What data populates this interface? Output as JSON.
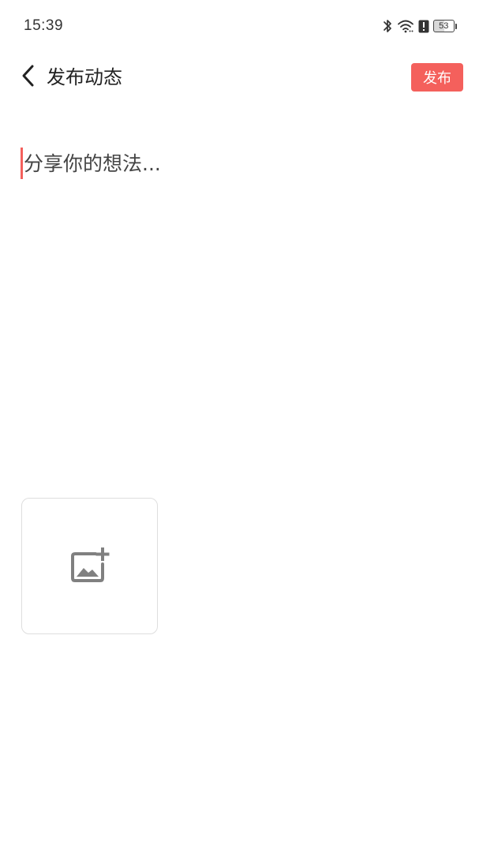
{
  "status_bar": {
    "time": "15:39",
    "battery_level": "53",
    "icons": [
      "bluetooth-icon",
      "wifi-icon",
      "alert-icon",
      "battery-icon"
    ]
  },
  "header": {
    "title": "发布动态",
    "publish_label": "发布",
    "back_icon": "chevron-left-icon"
  },
  "editor": {
    "placeholder": "分享你的想法..."
  },
  "media": {
    "add_image_icon": "add-image-icon"
  },
  "colors": {
    "accent": "#f4605c",
    "text_primary": "#222222",
    "tile_border": "#dedede",
    "icon_gray": "#808080"
  }
}
